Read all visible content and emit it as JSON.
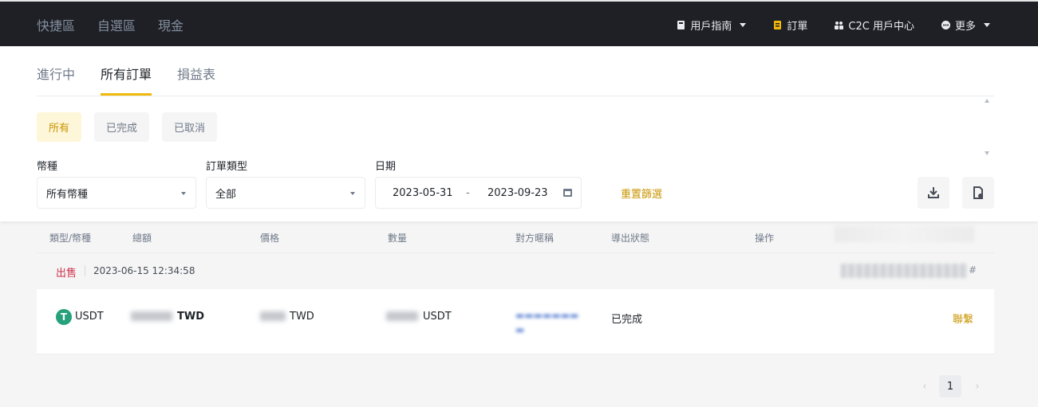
{
  "topbar": {
    "nav": [
      "快捷區",
      "自選區",
      "現金"
    ],
    "right": {
      "guide": "用戶指南",
      "orders": "訂單",
      "c2c_center": "C2C 用戶中心",
      "more": "更多"
    },
    "icons": {
      "guide": "book-icon",
      "orders": "document-icon",
      "c2c_center": "users-icon",
      "more": "more-dots-icon"
    }
  },
  "tabs": [
    "進行中",
    "所有訂單",
    "損益表"
  ],
  "active_tab": "所有訂單",
  "status_filters": [
    "所有",
    "已完成",
    "已取消"
  ],
  "active_status_filter": "所有",
  "filters": {
    "currency": {
      "label": "幣種",
      "value": "所有幣種"
    },
    "order_type": {
      "label": "訂單類型",
      "value": "全部"
    },
    "date": {
      "label": "日期",
      "start": "2023-05-31",
      "separator": "-",
      "end": "2023-09-23"
    },
    "reset": "重置篩選"
  },
  "actions": {
    "download_icon": "download-icon",
    "export_history_icon": "file-history-icon"
  },
  "table": {
    "headers": [
      "類型/幣種",
      "總額",
      "價格",
      "數量",
      "對方暱稱",
      "導出狀態",
      "操作"
    ],
    "groups": [
      {
        "side": "出售",
        "datetime": "2023-06-15 12:34:58",
        "rows": [
          {
            "coin": "USDT",
            "total_unit": "TWD",
            "price_unit": "TWD",
            "quantity_unit": "USDT",
            "status": "已完成",
            "action": "聯繫"
          }
        ]
      }
    ]
  },
  "pagination": {
    "current": "1",
    "prev": "‹",
    "next": "›"
  },
  "colors": {
    "accent": "#f0b90b",
    "sell": "#cf304a",
    "link": "#c99400",
    "topbar": "#1e2026",
    "usdt": "#26a17b"
  }
}
